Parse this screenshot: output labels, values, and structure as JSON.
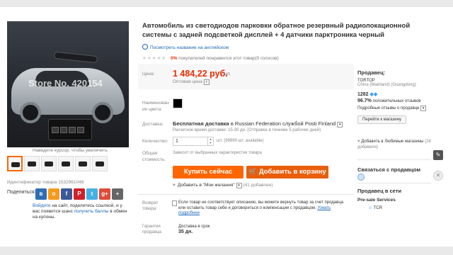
{
  "product": {
    "title": "Автомобиль из светодиодов парковки обратное резервный радиолокационной системы с задней подсветкой дисплей + 4 датчики парктроника черный",
    "translate_link": "Посмотреть название на английском",
    "rating_pct": "0%",
    "rating_text": "покупателей понравился этот товар(0 голосов)",
    "watermark": "Store No. 420154",
    "zoom_hint": "Наведите курсор, чтобы увеличить",
    "product_id": "Идентификатор товара 1532961048"
  },
  "price": {
    "label": "Цена:",
    "value": "1 484,22 руб.",
    "per": "/ шт.",
    "wholesale": "Оптовая цена"
  },
  "options": {
    "color_label": "Наименован ие цвета:",
    "shipping_label": "Доставка:",
    "shipping_title": "Бесплатная доставка",
    "shipping_dest": "в Russian Federation службой Posti Finland",
    "shipping_eta": "Расчетное время доставки: 15-30 дн. (Отправка в течение 5 рабочих дней)",
    "qty_label": "Количество:",
    "qty_value": "1",
    "qty_avail": "шт. (99999 шт. available)",
    "total_label": "Общая стоимость:",
    "total_note": "Зависит от выбранных характеристик товара"
  },
  "actions": {
    "buy_now": "Купить сейчас",
    "add_to_cart": "Добавить в корзину",
    "wishlist": "Добавить в \"Мои желания\"",
    "wishlist_count": "(41 добавлен)"
  },
  "returns": {
    "label": "Возврат товара:",
    "text": "Если товар не соответствует описанию, вы можете вернуть товар за счет продавца или оставить товар себе и договориться о компенсации с продавцом.",
    "link": "Узнать подробнее"
  },
  "guarantee": {
    "label": "Гарантии продавца:",
    "text": "Доставка в срок",
    "days": "35 дн."
  },
  "seller": {
    "heading": "Продавец:",
    "name": "TORTOP",
    "location": "China (Mainland) (Guangdong)",
    "score": "1282",
    "positive_pct": "96.7%",
    "positive_text": "положительных отзывов",
    "details_link": "Подробные отзывы о продавце",
    "shop_button": "Перейти к магазину",
    "favorites": "Добавить в Любимые магазины",
    "favorites_count": "(28 добавили)"
  },
  "contact": {
    "heading": "Связаться с продавцом",
    "online_heading": "Продавец в сети",
    "presale": "Pre-sale Services",
    "tcr": "TCR"
  },
  "share": {
    "label": "Поделиться:",
    "signin_text_before": "Войдите",
    "signin_text_mid": "на сайт, поделитесь ссылкой, и у вас появится шанс",
    "signin_link2": "получить баллы",
    "signin_text_end": "в обмен на купоны."
  },
  "colors": {
    "accent": "#ff6600",
    "price": "#e62e04",
    "link": "#1a66b8"
  }
}
